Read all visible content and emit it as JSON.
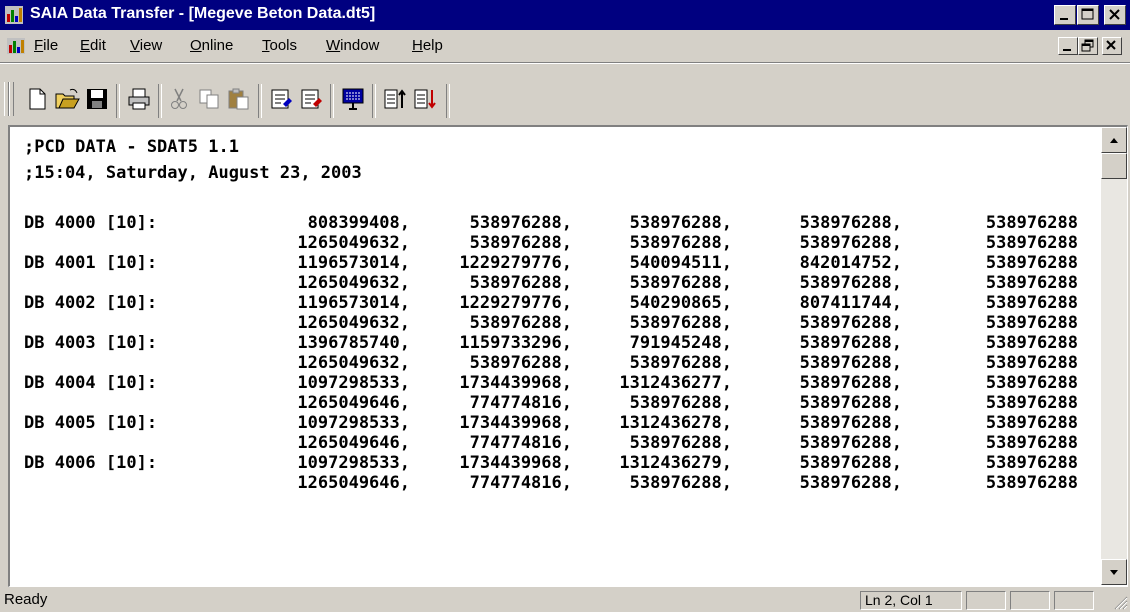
{
  "window": {
    "title": "SAIA Data Transfer - [Megeve Beton Data.dt5]"
  },
  "menu": {
    "items": [
      {
        "label_underlined": "F",
        "label_rest": "ile"
      },
      {
        "label_underlined": "E",
        "label_rest": "dit"
      },
      {
        "label_underlined": "V",
        "label_rest": "iew"
      },
      {
        "label_underlined": "O",
        "label_rest": "nline"
      },
      {
        "label_underlined": "T",
        "label_rest": "ools"
      },
      {
        "label_underlined": "W",
        "label_rest": "indow"
      },
      {
        "label_underlined": "H",
        "label_rest": "elp"
      }
    ]
  },
  "toolbar": {
    "icons": [
      "new-file-icon",
      "open-folder-icon",
      "save-icon",
      "print-icon",
      "cut-icon",
      "copy-icon",
      "paste-icon",
      "upload-icon",
      "download-icon",
      "online-icon",
      "sort-ascending-icon",
      "sort-descending-icon"
    ]
  },
  "document": {
    "header_lines": [
      ";PCD DATA - SDAT5 1.1",
      ";15:04, Saturday, August 23, 2003"
    ],
    "blocks": [
      {
        "label": "DB 4000 [10]:",
        "rows": [
          [
            "808399408,",
            "538976288,",
            "538976288,",
            "538976288,",
            "538976288"
          ],
          [
            "1265049632,",
            "538976288,",
            "538976288,",
            "538976288,",
            "538976288"
          ]
        ]
      },
      {
        "label": "DB 4001 [10]:",
        "rows": [
          [
            "1196573014,",
            "1229279776,",
            "540094511,",
            "842014752,",
            "538976288"
          ],
          [
            "1265049632,",
            "538976288,",
            "538976288,",
            "538976288,",
            "538976288"
          ]
        ]
      },
      {
        "label": "DB 4002 [10]:",
        "rows": [
          [
            "1196573014,",
            "1229279776,",
            "540290865,",
            "807411744,",
            "538976288"
          ],
          [
            "1265049632,",
            "538976288,",
            "538976288,",
            "538976288,",
            "538976288"
          ]
        ]
      },
      {
        "label": "DB 4003 [10]:",
        "rows": [
          [
            "1396785740,",
            "1159733296,",
            "791945248,",
            "538976288,",
            "538976288"
          ],
          [
            "1265049632,",
            "538976288,",
            "538976288,",
            "538976288,",
            "538976288"
          ]
        ]
      },
      {
        "label": "DB 4004 [10]:",
        "rows": [
          [
            "1097298533,",
            "1734439968,",
            "1312436277,",
            "538976288,",
            "538976288"
          ],
          [
            "1265049646,",
            "774774816,",
            "538976288,",
            "538976288,",
            "538976288"
          ]
        ]
      },
      {
        "label": "DB 4005 [10]:",
        "rows": [
          [
            "1097298533,",
            "1734439968,",
            "1312436278,",
            "538976288,",
            "538976288"
          ],
          [
            "1265049646,",
            "774774816,",
            "538976288,",
            "538976288,",
            "538976288"
          ]
        ]
      },
      {
        "label": "DB 4006 [10]:",
        "rows": [
          [
            "1097298533,",
            "1734439968,",
            "1312436279,",
            "538976288,",
            "538976288"
          ],
          [
            "1265049646,",
            "774774816,",
            "538976288,",
            "538976288,",
            "538976288"
          ]
        ]
      }
    ]
  },
  "status": {
    "message": "Ready",
    "position": "Ln 2, Col 1"
  },
  "colors": {
    "titlebar": "#000080",
    "face": "#d4d0c8"
  }
}
